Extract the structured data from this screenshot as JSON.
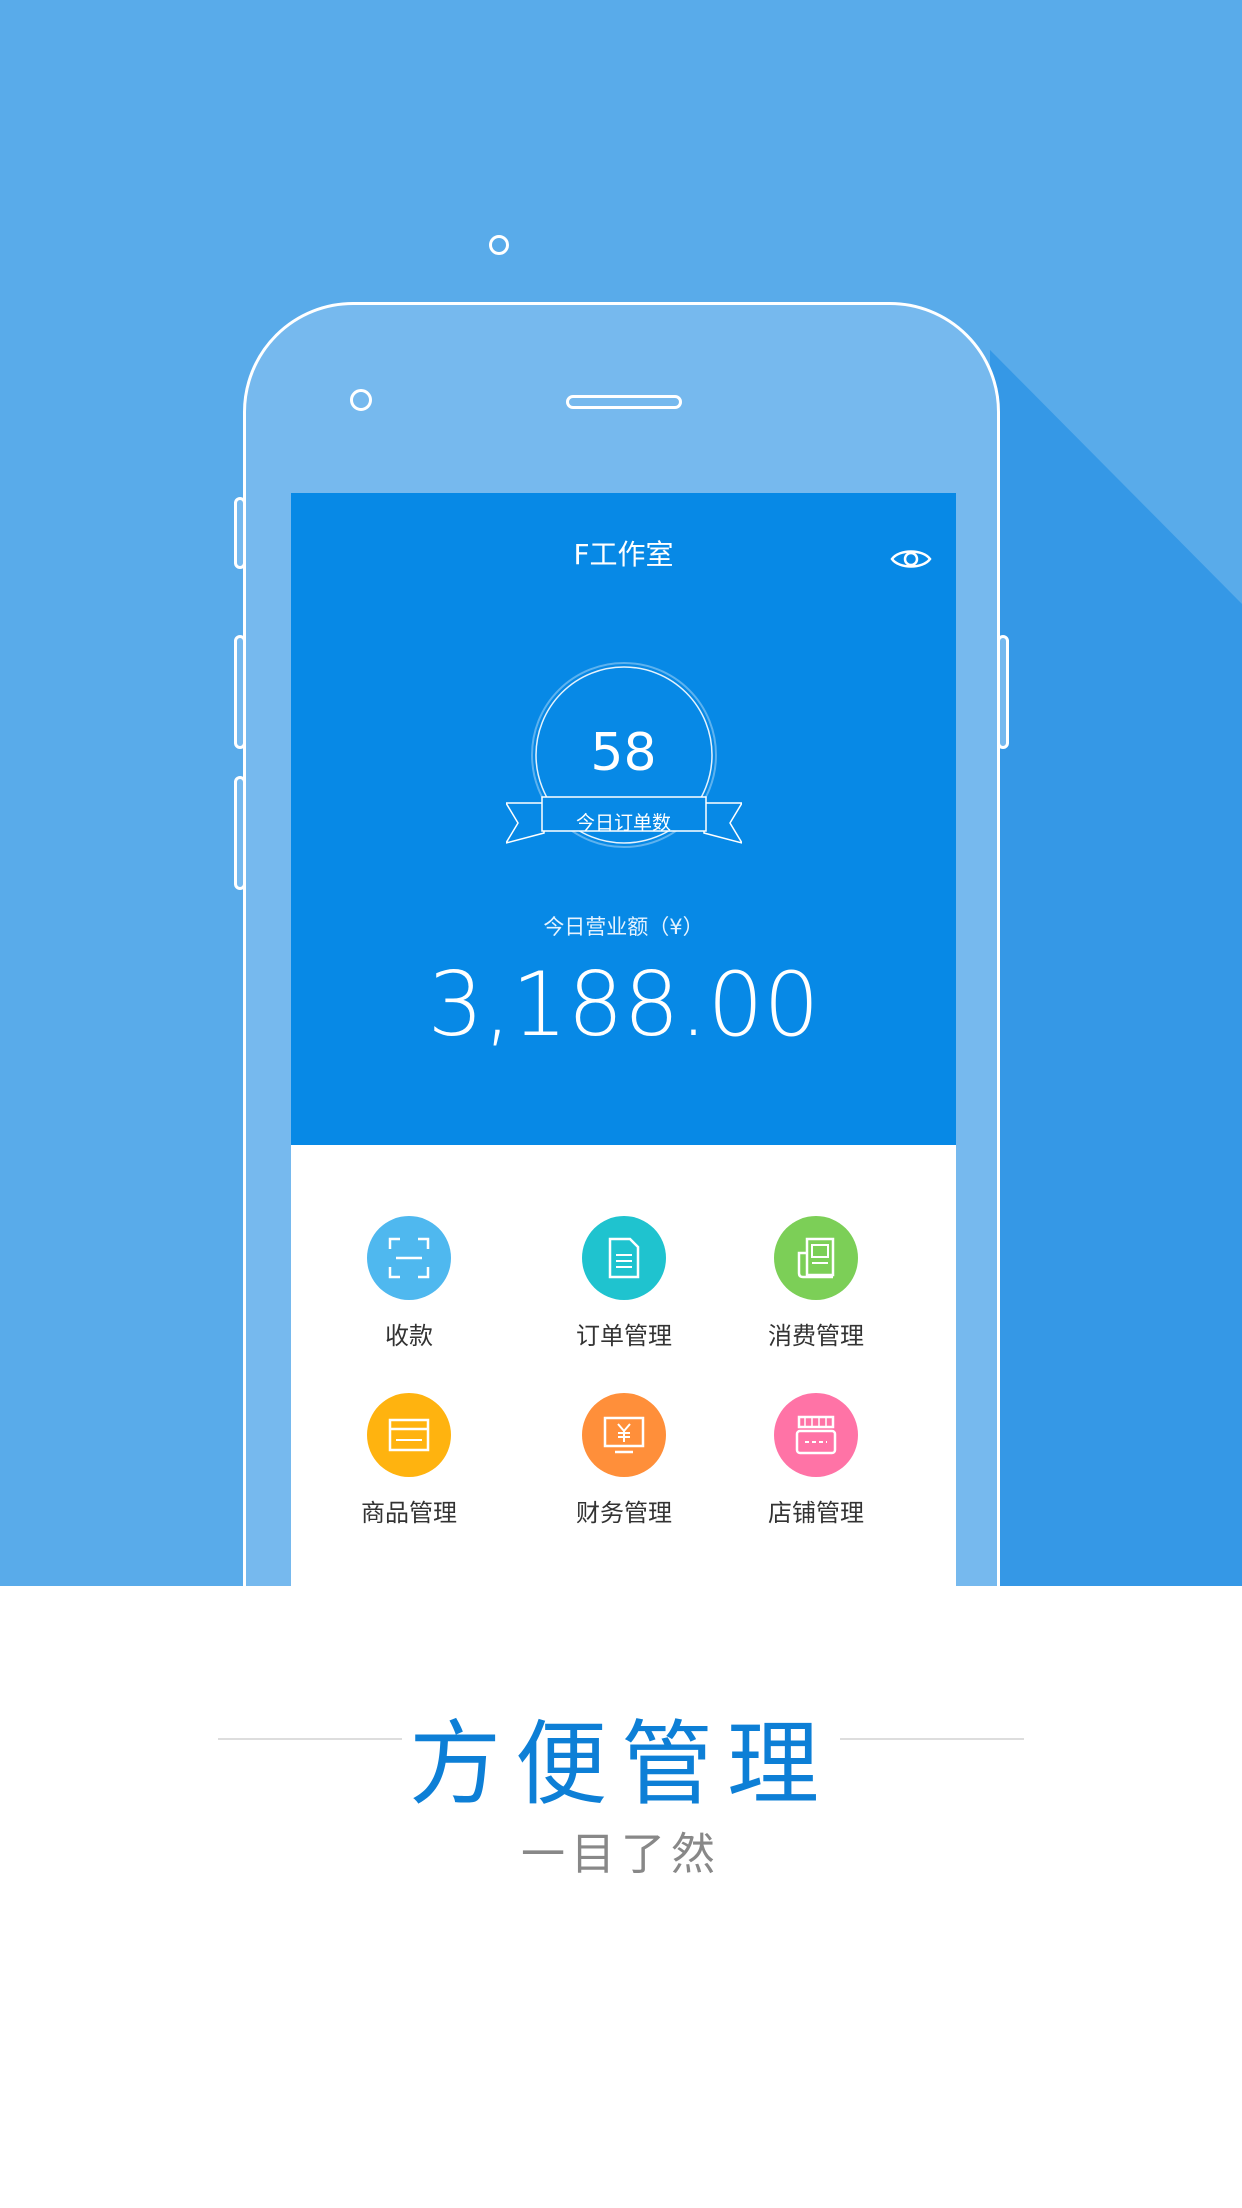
{
  "app": {
    "title": "F工作室",
    "order_count": "58",
    "order_label": "今日订单数",
    "revenue_label": "今日营业额（¥）",
    "revenue_value": "3,188.00"
  },
  "menu": [
    {
      "label": "收款",
      "icon": "scan-icon",
      "color": "#4fb8ef"
    },
    {
      "label": "订单管理",
      "icon": "document-icon",
      "color": "#1fc3cf"
    },
    {
      "label": "消费管理",
      "icon": "receipt-icon",
      "color": "#7ccf57"
    },
    {
      "label": "商品管理",
      "icon": "card-icon",
      "color": "#ffb30f"
    },
    {
      "label": "财务管理",
      "icon": "finance-icon",
      "color": "#ff8f3a"
    },
    {
      "label": "店铺管理",
      "icon": "store-icon",
      "color": "#ff73a6"
    }
  ],
  "promo": {
    "tagline": "方便管理",
    "subtitle": "一目了然"
  },
  "colors": {
    "background": "#59abea",
    "header": "#0789e6",
    "accent": "#0d7fd6"
  }
}
